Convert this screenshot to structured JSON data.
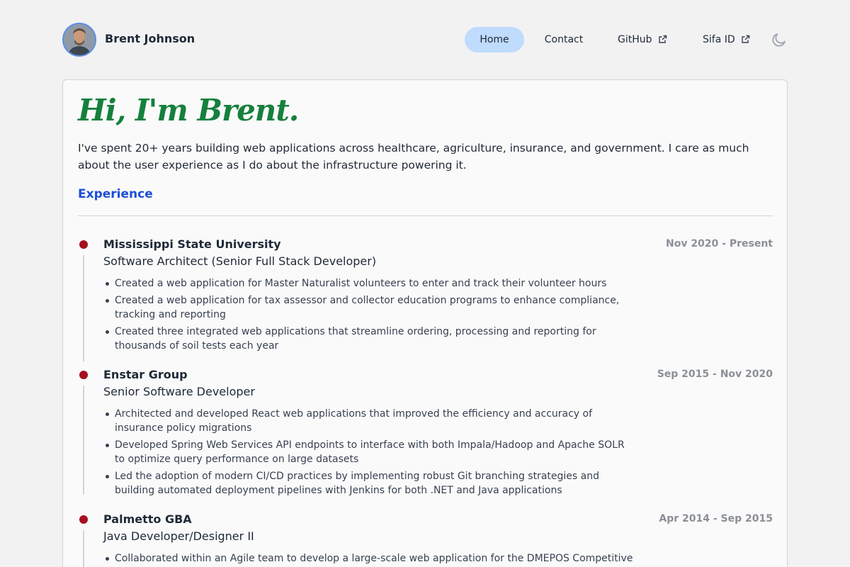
{
  "header": {
    "brand_name": "Brent Johnson",
    "nav": {
      "home": "Home",
      "contact": "Contact",
      "github": "GitHub",
      "sifa": "Sifa ID"
    }
  },
  "hero": {
    "title": "Hi, I'm Brent.",
    "intro": "I've spent 20+ years building web applications across healthcare, agriculture, insurance, and government. I care as much about the user experience as I do about the infrastructure powering it."
  },
  "experience": {
    "heading": "Experience",
    "jobs": [
      {
        "company": "Mississippi State University",
        "role": "Software Architect (Senior Full Stack Developer)",
        "dates": "Nov 2020 - Present",
        "bullets": [
          "Created a web application for Master Naturalist volunteers to enter and track their volunteer hours",
          "Created a web application for tax assessor and collector education programs to enhance compliance, tracking and reporting",
          "Created three integrated web applications that streamline ordering, processing and reporting for thousands of soil tests each year"
        ]
      },
      {
        "company": "Enstar Group",
        "role": "Senior Software Developer",
        "dates": "Sep 2015 - Nov 2020",
        "bullets": [
          "Architected and developed React web applications that improved the efficiency and accuracy of insurance policy migrations",
          "Developed Spring Web Services API endpoints to interface with both Impala/Hadoop and Apache SOLR to optimize query performance on large datasets",
          "Led the adoption of modern CI/CD practices by implementing robust Git branching strategies and building automated deployment pipelines with Jenkins for both .NET and Java applications"
        ]
      },
      {
        "company": "Palmetto GBA",
        "role": "Java Developer/Designer II",
        "dates": "Apr 2014 - Sep 2015",
        "bullets": [
          "Collaborated within an Agile team to develop a large-scale web application for the DMEPOS Competitive Bidding program, delivering key features for supplier bidding and contract management"
        ]
      }
    ]
  },
  "colors": {
    "accent_green": "#15803d",
    "accent_blue": "#1d4ed8",
    "timeline_dot": "#a50f1f",
    "nav_active": "#bfdbfe"
  },
  "icons": [
    "avatar-photo",
    "external-link-icon",
    "moon-icon"
  ]
}
